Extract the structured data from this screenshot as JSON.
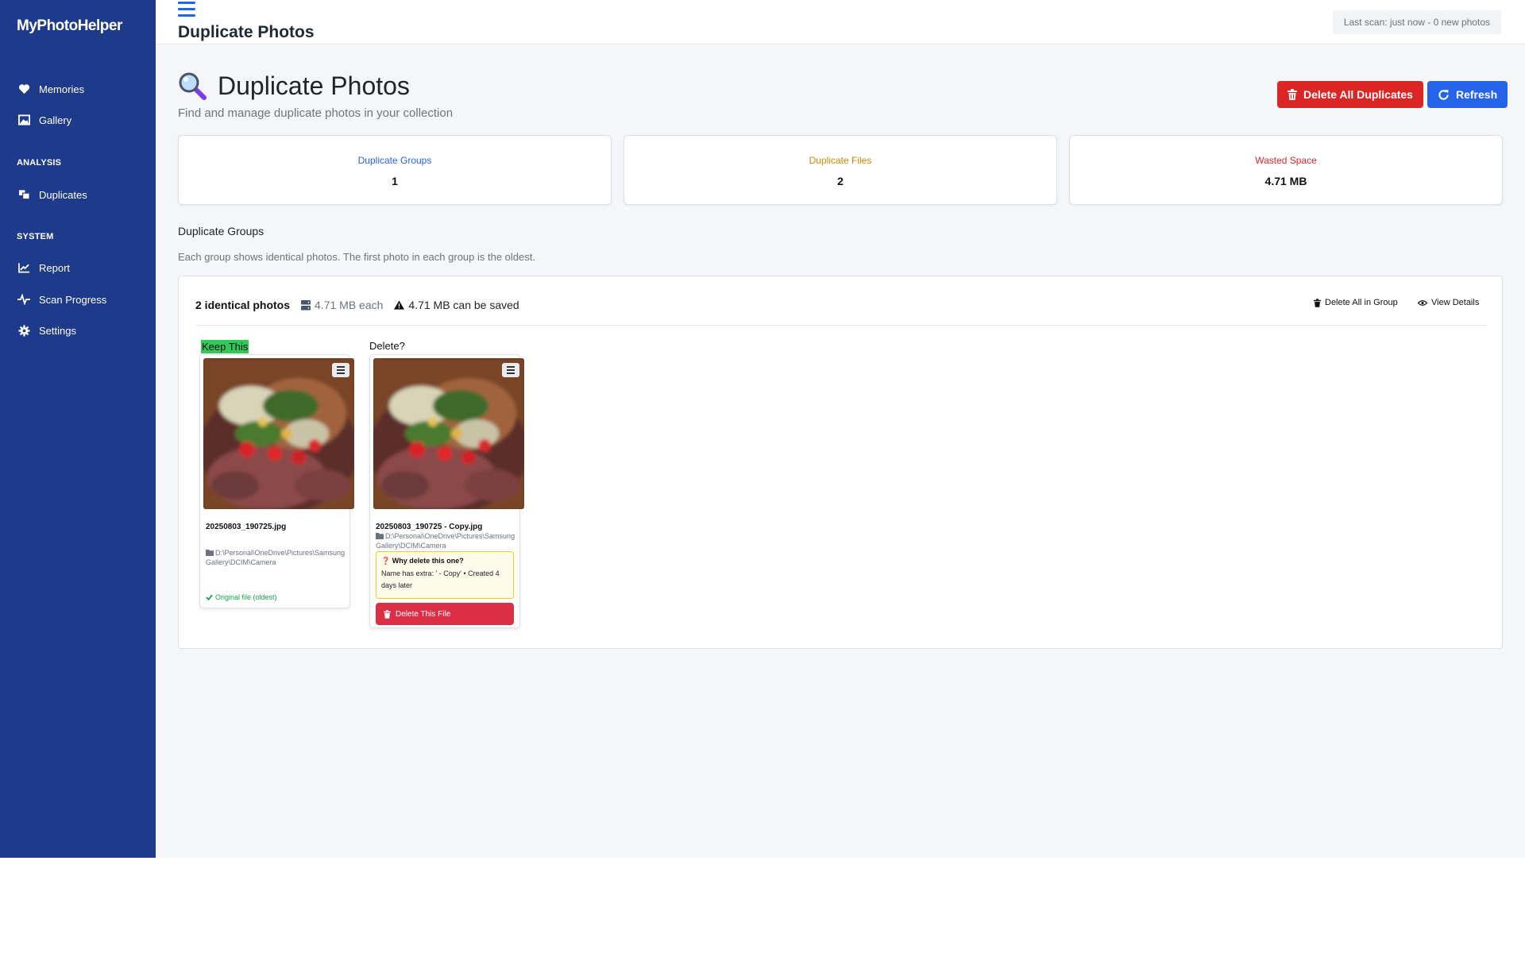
{
  "app": {
    "brand": "MyPhotoHelper"
  },
  "sidebar": {
    "items_top": [
      {
        "label": "Memories",
        "icon": "heart-icon"
      },
      {
        "label": "Gallery",
        "icon": "image-icon"
      }
    ],
    "analysis_heading": "ANALYSIS",
    "analysis_items": [
      {
        "label": "Duplicates",
        "icon": "duplicate-icon"
      }
    ],
    "system_heading": "SYSTEM",
    "system_items": [
      {
        "label": "Report",
        "icon": "chart-line-icon"
      },
      {
        "label": "Scan Progress",
        "icon": "pulse-icon"
      },
      {
        "label": "Settings",
        "icon": "gear-icon"
      }
    ]
  },
  "topbar": {
    "title": "Duplicate Photos",
    "scan_status": "Last scan: just now - 0 new photos"
  },
  "header": {
    "title": "Duplicate Photos",
    "subtitle": "Find and manage duplicate photos in your collection",
    "delete_all_label": "Delete All Duplicates",
    "refresh_label": "Refresh"
  },
  "stats": [
    {
      "label": "Duplicate Groups",
      "value": "1",
      "color": "#2563eb"
    },
    {
      "label": "Duplicate Files",
      "value": "2",
      "color": "#ca8a04"
    },
    {
      "label": "Wasted Space",
      "value": "4.71 MB",
      "color": "#dc2626"
    }
  ],
  "section": {
    "title": "Duplicate Groups",
    "description": "Each group shows identical photos. The first photo in each group is the oldest."
  },
  "group": {
    "count": "2 identical photos",
    "size_each": "4.71 MB each",
    "savings": "4.71 MB can be saved",
    "delete_all_in_group": "Delete All in Group",
    "view_details": "View Details",
    "keep_label": "Keep This",
    "delete_label": "Delete?",
    "photos": [
      {
        "filename": "20250803_190725.jpg",
        "path": "D:\\Personal\\OneDrive\\Pictures\\Samsung Gallery\\DCIM\\Camera",
        "original_note": "Original file (oldest)"
      },
      {
        "filename": "20250803_190725 - Copy.jpg",
        "path": "D:\\Personal\\OneDrive\\Pictures\\Samsung Gallery\\DCIM\\Camera",
        "why_title": "Why delete this one?",
        "why_desc": "Name has extra: ' - Copy' • Created 4 days later",
        "delete_label": "Delete This File"
      }
    ]
  },
  "colors": {
    "sidebar": "#1e3a8a",
    "danger": "#dc2626",
    "primary": "#2563eb",
    "keep": "#34c759"
  }
}
